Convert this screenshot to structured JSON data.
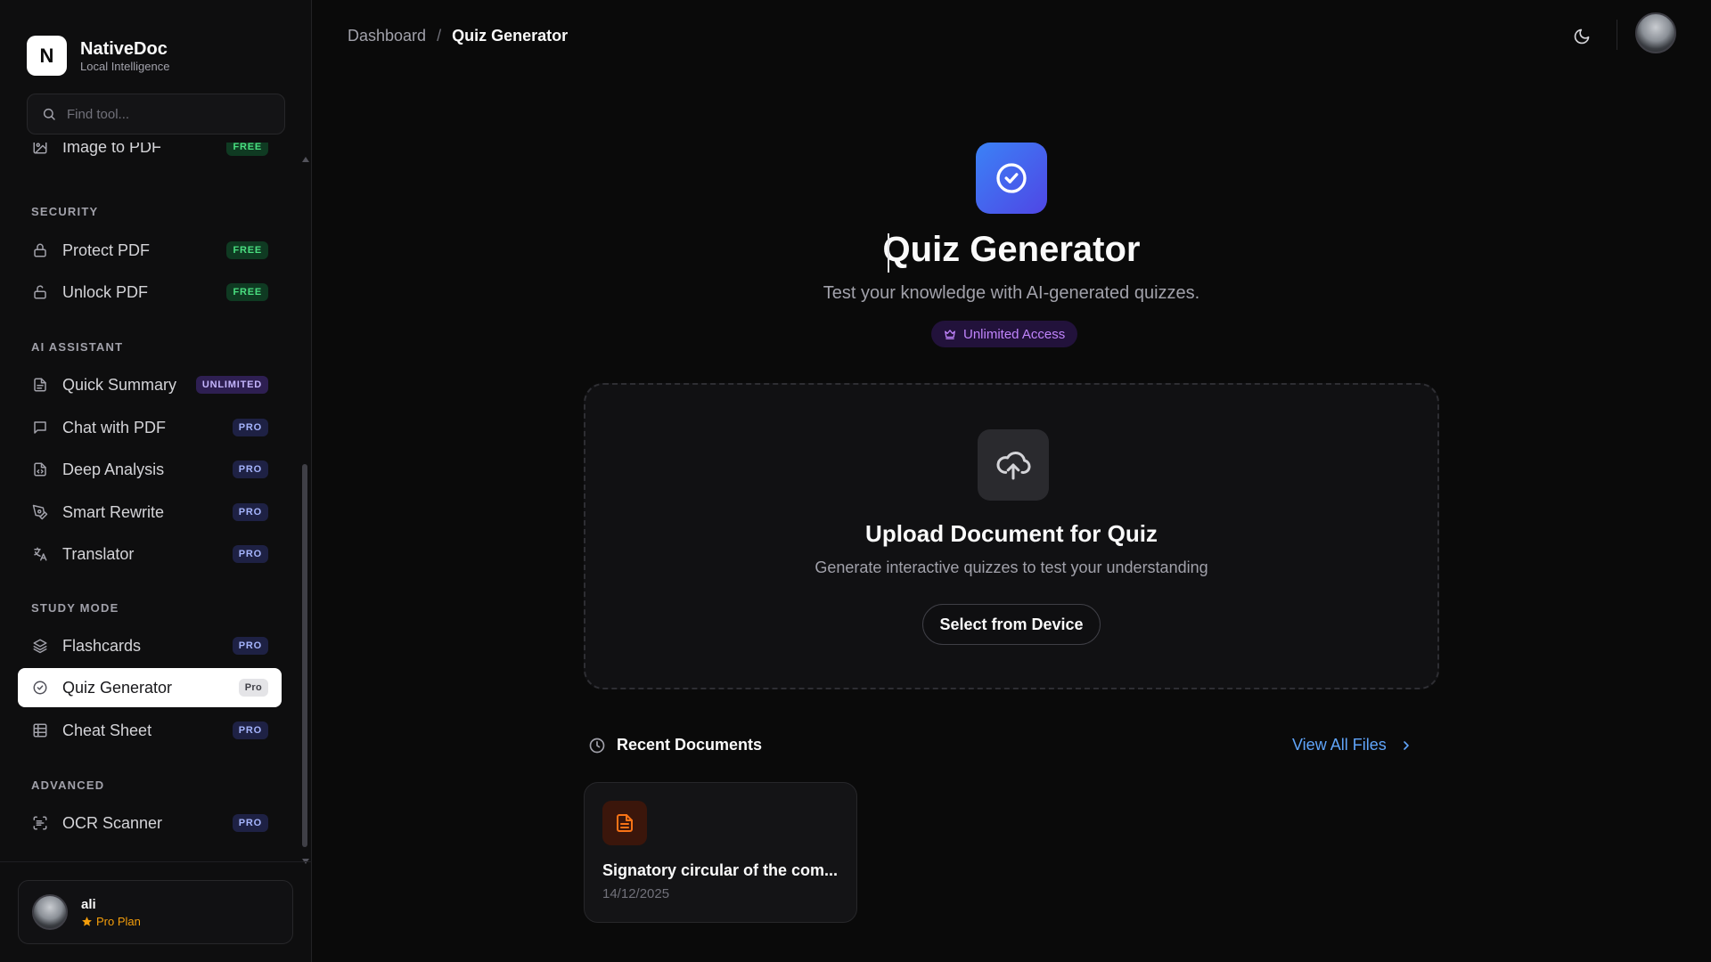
{
  "brand": {
    "logo_letter": "N",
    "name": "NativeDoc",
    "tagline": "Local Intelligence"
  },
  "search": {
    "placeholder": "Find tool..."
  },
  "sections": [
    {
      "title": "SECURITY"
    },
    {
      "title": "AI ASSISTANT"
    },
    {
      "title": "STUDY MODE"
    },
    {
      "title": "ADVANCED"
    }
  ],
  "nav": {
    "partial_item": {
      "label": "Image to PDF",
      "badge": "FREE"
    },
    "protect_pdf": {
      "label": "Protect PDF",
      "badge": "FREE",
      "icon": "lock-icon"
    },
    "unlock_pdf": {
      "label": "Unlock PDF",
      "badge": "FREE",
      "icon": "unlock-icon"
    },
    "quick_summary": {
      "label": "Quick Summary",
      "badge": "UNLIMITED",
      "icon": "document-icon"
    },
    "chat_pdf": {
      "label": "Chat with PDF",
      "badge": "PRO",
      "icon": "chat-icon"
    },
    "deep_analysis": {
      "label": "Deep Analysis",
      "badge": "PRO",
      "icon": "file-code-icon"
    },
    "smart_rewrite": {
      "label": "Smart Rewrite",
      "badge": "PRO",
      "icon": "pen-tool-icon"
    },
    "translator": {
      "label": "Translator",
      "badge": "PRO",
      "icon": "translate-icon"
    },
    "flashcards": {
      "label": "Flashcards",
      "badge": "PRO",
      "icon": "layers-icon"
    },
    "quiz_generator": {
      "label": "Quiz Generator",
      "badge": "Pro",
      "icon": "check-circle-icon"
    },
    "cheat_sheet": {
      "label": "Cheat Sheet",
      "badge": "PRO",
      "icon": "grid-icon"
    },
    "ocr_scanner": {
      "label": "OCR Scanner",
      "badge": "PRO",
      "icon": "scan-icon"
    }
  },
  "user": {
    "name": "ali",
    "plan": "Pro Plan"
  },
  "breadcrumb": {
    "parent": "Dashboard",
    "separator": "/",
    "current": "Quiz Generator"
  },
  "hero": {
    "title": "Quiz Generator",
    "subtitle": "Test your knowledge with AI-generated quizzes.",
    "access_label": "Unlimited Access"
  },
  "upload": {
    "title": "Upload Document for Quiz",
    "subtitle": "Generate interactive quizzes to test your understanding",
    "button": "Select from Device"
  },
  "recent": {
    "title": "Recent Documents",
    "view_all": "View All Files",
    "documents": [
      {
        "name": "Signatory circular of the com...",
        "date": "14/12/2025"
      }
    ]
  },
  "colors": {
    "accent_blue": "#3b82f6",
    "accent_indigo": "#4f46e5",
    "link_blue": "#60a5fa",
    "free_green": "#4ade80",
    "pro_indigo": "#a5b4fc",
    "unlimited_purple": "#c4b5fd",
    "plan_amber": "#f59e0b",
    "doc_orange": "#f97316"
  }
}
